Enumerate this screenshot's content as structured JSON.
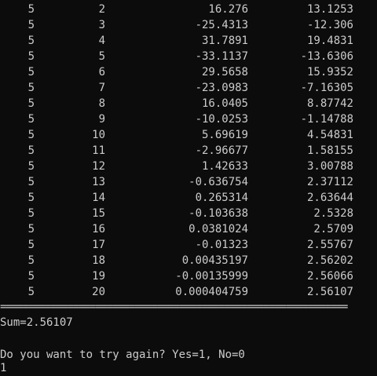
{
  "console": {
    "rows": [
      {
        "i": "5",
        "k": "2",
        "term": "16.276",
        "partial": "13.1253"
      },
      {
        "i": "5",
        "k": "3",
        "term": "-25.4313",
        "partial": "-12.306"
      },
      {
        "i": "5",
        "k": "4",
        "term": "31.7891",
        "partial": "19.4831"
      },
      {
        "i": "5",
        "k": "5",
        "term": "-33.1137",
        "partial": "-13.6306"
      },
      {
        "i": "5",
        "k": "6",
        "term": "29.5658",
        "partial": "15.9352"
      },
      {
        "i": "5",
        "k": "7",
        "term": "-23.0983",
        "partial": "-7.16305"
      },
      {
        "i": "5",
        "k": "8",
        "term": "16.0405",
        "partial": "8.87742"
      },
      {
        "i": "5",
        "k": "9",
        "term": "-10.0253",
        "partial": "-1.14788"
      },
      {
        "i": "5",
        "k": "10",
        "term": "5.69619",
        "partial": "4.54831"
      },
      {
        "i": "5",
        "k": "11",
        "term": "-2.96677",
        "partial": "1.58155"
      },
      {
        "i": "5",
        "k": "12",
        "term": "1.42633",
        "partial": "3.00788"
      },
      {
        "i": "5",
        "k": "13",
        "term": "-0.636754",
        "partial": "2.37112"
      },
      {
        "i": "5",
        "k": "14",
        "term": "0.265314",
        "partial": "2.63644"
      },
      {
        "i": "5",
        "k": "15",
        "term": "-0.103638",
        "partial": "2.5328"
      },
      {
        "i": "5",
        "k": "16",
        "term": "0.0381024",
        "partial": "2.5709"
      },
      {
        "i": "5",
        "k": "17",
        "term": "-0.01323",
        "partial": "2.55767"
      },
      {
        "i": "5",
        "k": "18",
        "term": "0.00435197",
        "partial": "2.56202"
      },
      {
        "i": "5",
        "k": "19",
        "term": "-0.00135999",
        "partial": "2.56066"
      },
      {
        "i": "5",
        "k": "20",
        "term": "0.000404759",
        "partial": "2.56107"
      }
    ],
    "separator": "==============================================================",
    "sum_line": "Sum=2.56107",
    "prompt": "Do you want to try again? Yes=1, No=0",
    "input": "1"
  },
  "colors": {
    "background": "#0c0c0c",
    "text": "#cccccc"
  }
}
